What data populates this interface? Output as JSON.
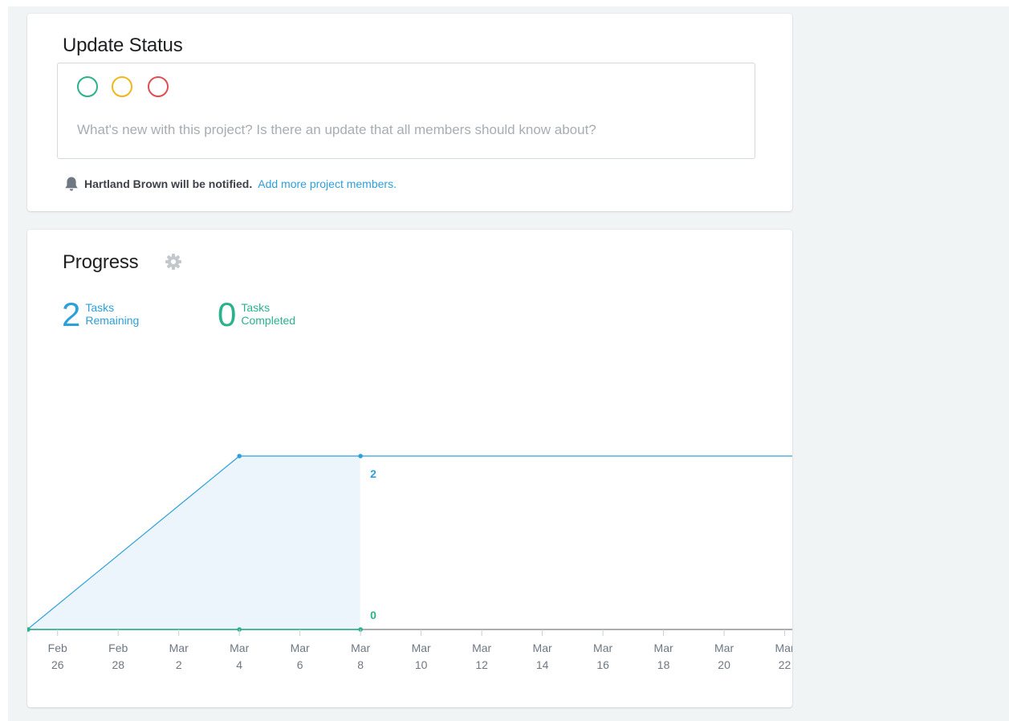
{
  "update_status": {
    "title": "Update Status",
    "status_options": [
      "green",
      "yellow",
      "red"
    ],
    "placeholder": "What's new with this project? Is there an update that all members should know about?",
    "notify_text": "Hartland Brown will be notified.",
    "notify_link": "Add more project members.",
    "icon": "bell-icon"
  },
  "progress": {
    "title": "Progress",
    "settings_icon": "gear-icon",
    "remaining": {
      "count": "2",
      "label": "Tasks Remaining"
    },
    "completed": {
      "count": "0",
      "label": "Tasks Completed"
    }
  },
  "colors": {
    "remaining": "#2d9fd9",
    "completed": "#2ab28c",
    "remaining_fill": "#ecf5fc",
    "status_green": "#2ab28c",
    "status_yellow": "#f2b61b",
    "status_red": "#e34d51",
    "link": "#2d9fd9"
  },
  "chart_data": {
    "type": "area",
    "x_ticks": [
      [
        "Feb",
        "26"
      ],
      [
        "Feb",
        "28"
      ],
      [
        "Mar",
        "2"
      ],
      [
        "Mar",
        "4"
      ],
      [
        "Mar",
        "6"
      ],
      [
        "Mar",
        "8"
      ],
      [
        "Mar",
        "10"
      ],
      [
        "Mar",
        "12"
      ],
      [
        "Mar",
        "14"
      ],
      [
        "Mar",
        "16"
      ],
      [
        "Mar",
        "18"
      ],
      [
        "Mar",
        "20"
      ],
      [
        "Mar",
        "22"
      ]
    ],
    "xlim": [
      "Feb 25",
      "Mar 22"
    ],
    "ylim": [
      0,
      2
    ],
    "today": "Mar 8",
    "series": [
      {
        "name": "Tasks Remaining",
        "points": [
          [
            "Feb 25",
            0
          ],
          [
            "Mar 4",
            2
          ],
          [
            "Mar 8",
            2
          ]
        ],
        "projection_to": "Mar 22"
      },
      {
        "name": "Tasks Completed",
        "points": [
          [
            "Feb 25",
            0
          ],
          [
            "Mar 4",
            0
          ],
          [
            "Mar 8",
            0
          ]
        ],
        "projection_to": "Mar 22"
      }
    ],
    "value_labels": [
      {
        "series": "Tasks Remaining",
        "at": "Mar 8",
        "text": "2"
      },
      {
        "series": "Tasks Completed",
        "at": "Mar 8",
        "text": "0"
      }
    ]
  }
}
